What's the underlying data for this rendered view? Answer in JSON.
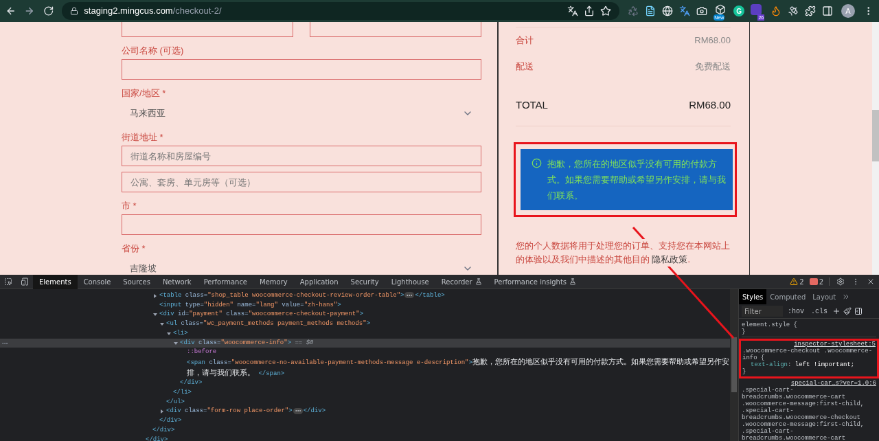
{
  "browser": {
    "url_host": "staging2.mingcus.com",
    "url_path": "/checkout-2/",
    "extensions": [
      {
        "kind": "recycle"
      },
      {
        "kind": "document"
      },
      {
        "kind": "globe"
      },
      {
        "kind": "translate"
      },
      {
        "kind": "camera"
      },
      {
        "kind": "new",
        "badge": "New"
      },
      {
        "kind": "letter",
        "letter": "G"
      },
      {
        "kind": "counter",
        "badge": "26"
      },
      {
        "kind": "flame"
      },
      {
        "kind": "satellite"
      },
      {
        "kind": "puzzle"
      },
      {
        "kind": "sidepanel"
      }
    ],
    "avatar": "A"
  },
  "checkout_form": [
    {
      "kind": "pair"
    },
    {
      "kind": "label",
      "text": "公司名称 (可选)"
    },
    {
      "kind": "input"
    },
    {
      "kind": "label",
      "text": "国家/地区 *"
    },
    {
      "kind": "select",
      "value": "马来西亚"
    },
    {
      "kind": "label",
      "text": "街道地址 *"
    },
    {
      "kind": "input",
      "placeholder": "街道名称和房屋编号"
    },
    {
      "kind": "input",
      "placeholder": "公寓、套房、单元房等（可选）"
    },
    {
      "kind": "label",
      "text": "市 *"
    },
    {
      "kind": "input"
    },
    {
      "kind": "label",
      "text": "省份 *"
    },
    {
      "kind": "select",
      "value": "吉隆坡"
    }
  ],
  "order_summary": {
    "rows": [
      {
        "label": "合计",
        "value": "RM68.00"
      },
      {
        "label": "配送",
        "value": "免费配送"
      }
    ],
    "total": {
      "label": "TOTAL",
      "value": "RM68.00"
    },
    "notice": "抱歉，您所在的地区似乎没有可用的付款方式。如果您需要帮助或希望另作安排，请与我们联系。",
    "privacy": {
      "text": "您的个人数据将用于处理您的订单、支持您在本网站上的体验以及我们中描述的其他目的",
      "link": "隐私政策",
      "end": "."
    }
  },
  "devtools": {
    "tabs": [
      {
        "label": "Elements",
        "selected": true,
        "kind": "plain"
      },
      {
        "label": "Console",
        "selected": false,
        "kind": "plain"
      },
      {
        "label": "Sources",
        "selected": false,
        "kind": "plain"
      },
      {
        "label": "Network",
        "selected": false,
        "kind": "plain"
      },
      {
        "label": "Performance",
        "selected": false,
        "kind": "plain"
      },
      {
        "label": "Memory",
        "selected": false,
        "kind": "plain"
      },
      {
        "label": "Application",
        "selected": false,
        "kind": "plain"
      },
      {
        "label": "Security",
        "selected": false,
        "kind": "plain"
      },
      {
        "label": "Lighthouse",
        "selected": false,
        "kind": "plain"
      },
      {
        "label": "Recorder",
        "selected": false,
        "kind": "experimental"
      },
      {
        "label": "Performance insights",
        "selected": false,
        "kind": "experimental"
      }
    ],
    "warnings": "2",
    "errors": "2",
    "elements": {
      "tree": [
        {
          "close": [
            {
              "kind": "tag",
              "text": "</div>"
            }
          ],
          "children": [
            {
              "close": [
                {
                  "kind": "tag",
                  "text": "</div>"
                }
              ],
              "children": [
                {
                  "expanded": false,
                  "line": [
                    {
                      "kind": "tag",
                      "text": "<table"
                    },
                    {
                      "kind": "attr",
                      "text": " class="
                    },
                    {
                      "kind": "val",
                      "text": "\"shop_table woocommerce-checkout-review-order-table\""
                    },
                    {
                      "kind": "tag",
                      "text": ">"
                    },
                    {
                      "kind": "more"
                    },
                    {
                      "kind": "tag",
                      "text": "</table>"
                    }
                  ]
                },
                {
                  "line": [
                    {
                      "kind": "tag",
                      "text": "<input"
                    },
                    {
                      "kind": "attr",
                      "text": " type="
                    },
                    {
                      "kind": "val",
                      "text": "\"hidden\""
                    },
                    {
                      "kind": "attr",
                      "text": " name="
                    },
                    {
                      "kind": "val",
                      "text": "\"lang\""
                    },
                    {
                      "kind": "attr",
                      "text": " value="
                    },
                    {
                      "kind": "val",
                      "text": "\"zh-hans\""
                    },
                    {
                      "kind": "tag",
                      "text": ">"
                    }
                  ]
                },
                {
                  "expanded": true,
                  "line": [
                    {
                      "kind": "tag",
                      "text": "<div"
                    },
                    {
                      "kind": "attr",
                      "text": " id="
                    },
                    {
                      "kind": "val",
                      "text": "\"payment\""
                    },
                    {
                      "kind": "attr",
                      "text": " class="
                    },
                    {
                      "kind": "val",
                      "text": "\"woocommerce-checkout-payment\""
                    },
                    {
                      "kind": "tag",
                      "text": ">"
                    }
                  ],
                  "close": [
                    {
                      "kind": "tag",
                      "text": "</div>"
                    }
                  ],
                  "children": [
                    {
                      "expanded": true,
                      "line": [
                        {
                          "kind": "tag",
                          "text": "<ul"
                        },
                        {
                          "kind": "attr",
                          "text": " class="
                        },
                        {
                          "kind": "val",
                          "text": "\"wc_payment_methods payment_methods methods\""
                        },
                        {
                          "kind": "tag",
                          "text": ">"
                        }
                      ],
                      "close": [
                        {
                          "kind": "tag",
                          "text": "</ul>"
                        }
                      ],
                      "children": [
                        {
                          "expanded": true,
                          "line": [
                            {
                              "kind": "tag",
                              "text": "<li>"
                            }
                          ],
                          "close": [
                            {
                              "kind": "tag",
                              "text": "</li>"
                            }
                          ],
                          "children": [
                            {
                              "expanded": true,
                              "selected": true,
                              "line": [
                                {
                                  "kind": "tag",
                                  "text": "<div"
                                },
                                {
                                  "kind": "attr",
                                  "text": " class="
                                },
                                {
                                  "kind": "val",
                                  "text": "\"woocommerce-info\""
                                },
                                {
                                  "kind": "tag",
                                  "text": ">"
                                },
                                {
                                  "kind": "ref",
                                  "text": " == $0"
                                }
                              ],
                              "close": [
                                {
                                  "kind": "tag",
                                  "text": "</div>"
                                }
                              ],
                              "children": [
                                {
                                  "line": [
                                    {
                                      "kind": "pseudo",
                                      "text": "::before"
                                    }
                                  ]
                                },
                                {
                                  "line": [
                                    {
                                      "kind": "tag",
                                      "text": "<span"
                                    },
                                    {
                                      "kind": "attr",
                                      "text": " class="
                                    },
                                    {
                                      "kind": "val",
                                      "text": "\"woocommerce-no-available-payment-methods-message e-description\""
                                    },
                                    {
                                      "kind": "tag",
                                      "text": ">"
                                    },
                                    {
                                      "kind": "text",
                                      "text": "抱歉，您所在的地区似乎没有可用的付款方式。如果您需要帮助或希望另作安排，请与我们联系。"
                                    },
                                    {
                                      "kind": "tag",
                                      "text": " </span>"
                                    }
                                  ]
                                }
                              ]
                            }
                          ]
                        }
                      ]
                    },
                    {
                      "expanded": false,
                      "line": [
                        {
                          "kind": "tag",
                          "text": "<div"
                        },
                        {
                          "kind": "attr",
                          "text": " class="
                        },
                        {
                          "kind": "val",
                          "text": "\"form-row place-order\""
                        },
                        {
                          "kind": "tag",
                          "text": ">"
                        },
                        {
                          "kind": "more"
                        },
                        {
                          "kind": "tag",
                          "text": "</div>"
                        }
                      ]
                    }
                  ]
                }
              ]
            }
          ]
        }
      ]
    },
    "styles": {
      "tabs": [
        {
          "label": "Styles",
          "selected": true
        },
        {
          "label": "Computed",
          "selected": false
        },
        {
          "label": "Layout",
          "selected": false
        }
      ],
      "filter_placeholder": "Filter",
      "toggles": [
        ":hov",
        ".cls"
      ],
      "rules": [
        {
          "selector": "element.style {",
          "close": "}"
        },
        {
          "selector": ".woocommerce-checkout .woocommerce-info {",
          "source": "inspector-stylesheet:5",
          "props": [
            {
              "name": "text-align",
              "colon": ":",
              "value": " left !important;"
            }
          ],
          "close": "}"
        },
        {
          "selector": ".special-cart-breadcrumbs.woocommerce-cart .woocommerce-message:first-child, .special-cart-breadcrumbs.woocommerce-checkout .woocommerce-message:first-child, .special-cart-breadcrumbs.woocommerce-cart",
          "source": "special-car…s?ver=1.0:6"
        }
      ]
    }
  }
}
